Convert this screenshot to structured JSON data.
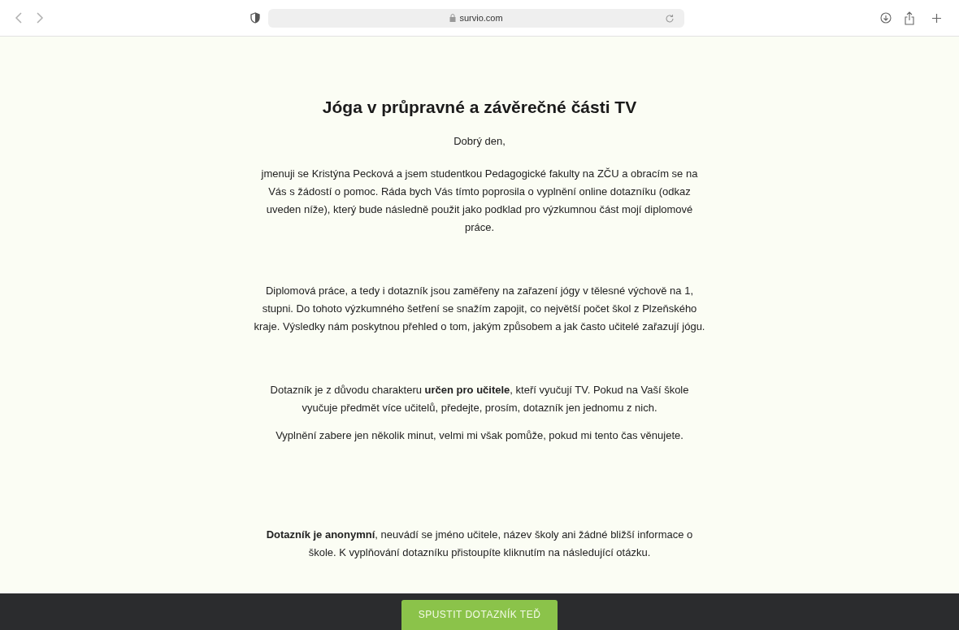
{
  "browser": {
    "address": "survio.com"
  },
  "page": {
    "title": "Jóga v průpravné a závěrečné části TV",
    "greeting": "Dobrý den,",
    "sections": [
      [
        "jmenuji se Kristýna Pecková a jsem studentkou Pedagogické fakulty na ZČU a obracím se na Vás s žádostí o pomoc. Ráda bych Vás tímto poprosila o vyplnění online dotazníku (odkaz uveden níže), který bude následně použit jako podklad pro výzkumnou část mojí diplomové práce."
      ],
      [
        "Diplomová práce, a tedy i dotazník jsou zaměřeny na zařazení jógy v tělesné výchově na 1, stupni. Do tohoto výzkumného šetření se snažím zapojit, co největší počet škol z Plzeňského kraje. Výsledky nám poskytnou přehled o tom, jakým způsobem a jak často učitelé zařazují jógu."
      ],
      [
        "Dotazník je z důvodu charakteru **určen pro učitele**, kteří vyučují TV. Pokud na Vaší škole vyučuje předmět více učitelů, předejte, prosím, dotazník jen jednomu z nich.",
        "Vyplnění zabere jen několik minut, velmi mi však pomůže, pokud mi tento čas věnujete."
      ],
      [
        "**Dotazník je anonymní**, neuvádí se jméno učitele, název školy ani žádné bližší informace o škole. K vyplňování dotazníku přistoupíte kliknutím na následující otázku."
      ]
    ]
  },
  "footer": {
    "button": "SPUSTIT DOTAZNÍK TEĎ"
  }
}
